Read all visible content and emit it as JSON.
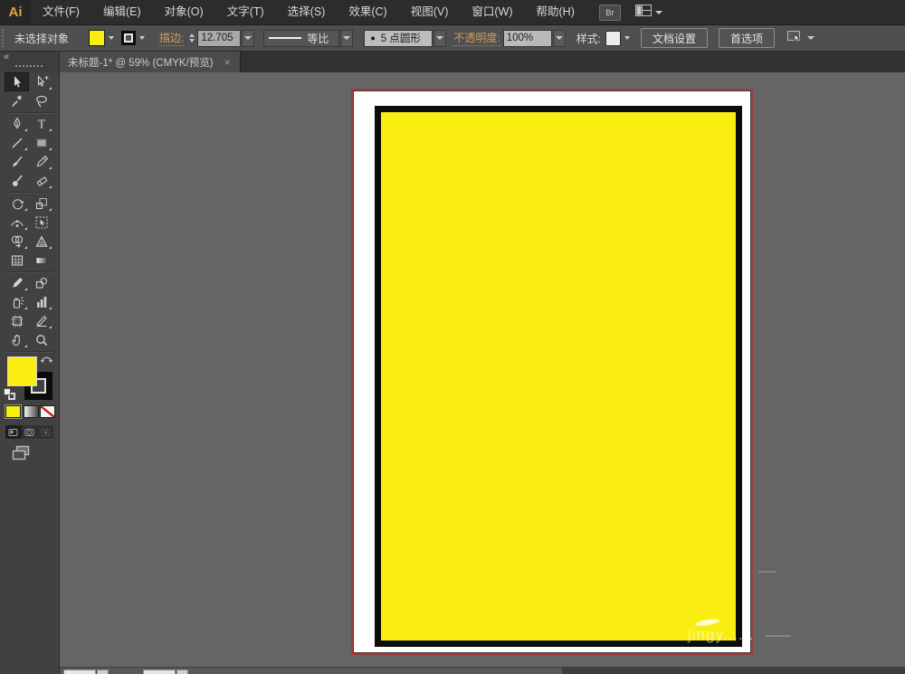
{
  "menu": {
    "logo": "Ai",
    "items": [
      {
        "name": "file",
        "label": "文件(F)"
      },
      {
        "name": "edit",
        "label": "编辑(E)"
      },
      {
        "name": "object",
        "label": "对象(O)"
      },
      {
        "name": "type",
        "label": "文字(T)"
      },
      {
        "name": "select",
        "label": "选择(S)"
      },
      {
        "name": "effect",
        "label": "效果(C)"
      },
      {
        "name": "view",
        "label": "视图(V)"
      },
      {
        "name": "window",
        "label": "窗口(W)"
      },
      {
        "name": "help",
        "label": "帮助(H)"
      }
    ],
    "bridge_label": "Br"
  },
  "control_bar": {
    "no_selection": "未选择对象",
    "stroke_label": "描边:",
    "stroke_weight": "12.705",
    "width_profile": "等比",
    "brush_dot": "●",
    "brush_name": "5 点圆形",
    "opacity_label": "不透明度:",
    "opacity_value": "100%",
    "style_label": "样式:",
    "document_setup": "文档设置",
    "preferences": "首选项"
  },
  "tab": {
    "title": "未标题-1* @ 59% (CMYK/预览)",
    "close": "×"
  },
  "toolbar": {
    "collapse_glyph": "«",
    "tools": [
      {
        "name": "selection",
        "active": true,
        "flyout": false
      },
      {
        "name": "direct-selection",
        "active": false,
        "flyout": true
      },
      {
        "name": "magic-wand",
        "active": false,
        "flyout": false
      },
      {
        "name": "lasso",
        "active": false,
        "flyout": false
      },
      {
        "name": "pen",
        "active": false,
        "flyout": true
      },
      {
        "name": "type",
        "active": false,
        "flyout": true
      },
      {
        "name": "line-segment",
        "active": false,
        "flyout": true
      },
      {
        "name": "rectangle",
        "active": false,
        "flyout": true
      },
      {
        "name": "paintbrush",
        "active": false,
        "flyout": false
      },
      {
        "name": "pencil",
        "active": false,
        "flyout": true
      },
      {
        "name": "blob-brush",
        "active": false,
        "flyout": false
      },
      {
        "name": "eraser",
        "active": false,
        "flyout": true
      },
      {
        "name": "rotate",
        "active": false,
        "flyout": true
      },
      {
        "name": "scale",
        "active": false,
        "flyout": true
      },
      {
        "name": "width",
        "active": false,
        "flyout": true
      },
      {
        "name": "free-transform",
        "active": false,
        "flyout": false
      },
      {
        "name": "shape-builder",
        "active": false,
        "flyout": true
      },
      {
        "name": "perspective-grid",
        "active": false,
        "flyout": true
      },
      {
        "name": "mesh",
        "active": false,
        "flyout": false
      },
      {
        "name": "gradient",
        "active": false,
        "flyout": false
      },
      {
        "name": "eyedropper",
        "active": false,
        "flyout": true
      },
      {
        "name": "blend",
        "active": false,
        "flyout": false
      },
      {
        "name": "symbol-sprayer",
        "active": false,
        "flyout": true
      },
      {
        "name": "column-graph",
        "active": false,
        "flyout": true
      },
      {
        "name": "artboard",
        "active": false,
        "flyout": false
      },
      {
        "name": "slice",
        "active": false,
        "flyout": true
      },
      {
        "name": "hand",
        "active": false,
        "flyout": true
      },
      {
        "name": "zoom",
        "active": false,
        "flyout": false
      }
    ]
  },
  "canvas": {
    "watermark": "jingy......"
  },
  "colors": {
    "object_fill": "#f9ed11",
    "object_stroke": "#0d0d0d",
    "artboard_guide": "#a63a3a",
    "link_orange": "#cf9d5d"
  }
}
